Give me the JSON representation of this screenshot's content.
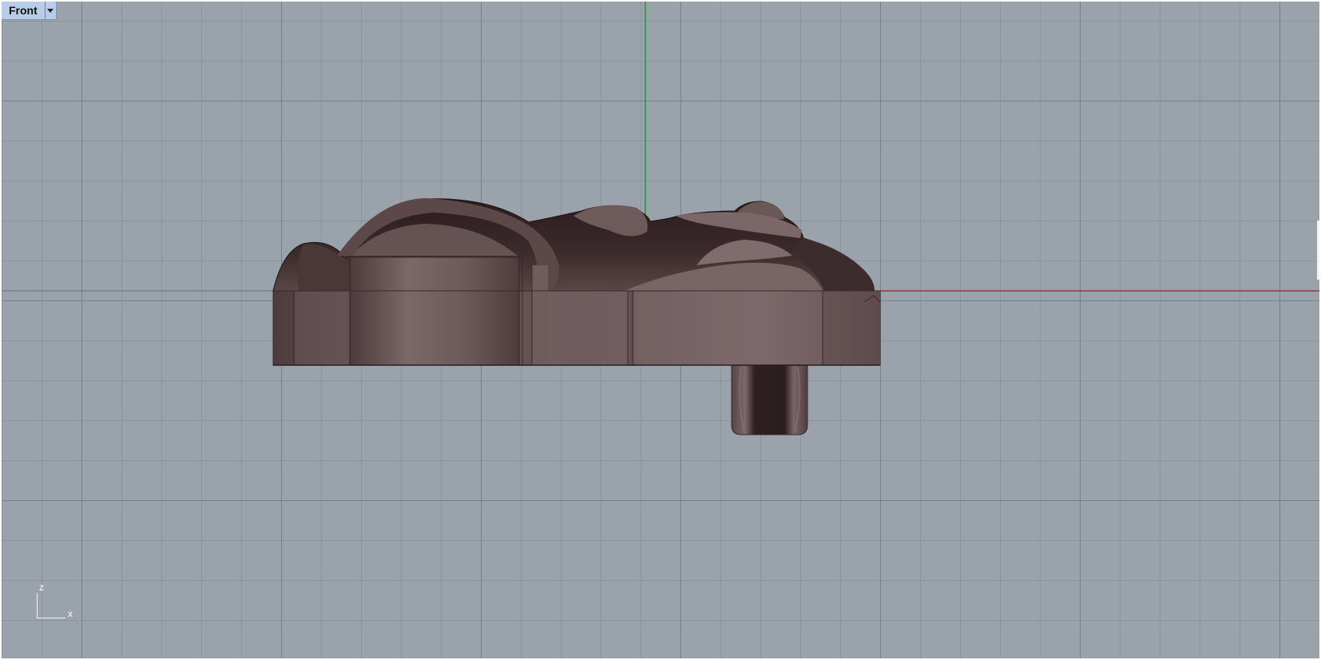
{
  "viewport": {
    "title": "Front",
    "menu_icon": "dropdown-triangle-icon",
    "background_color": "#9aa2ab",
    "grid_color": "#747c88",
    "x_axis_color": "#8b2a2a",
    "y_axis_color": "#1f9a2e",
    "model_color": "#5f4c4d"
  },
  "axis_widget": {
    "z_label": "z",
    "x_label": "x"
  }
}
